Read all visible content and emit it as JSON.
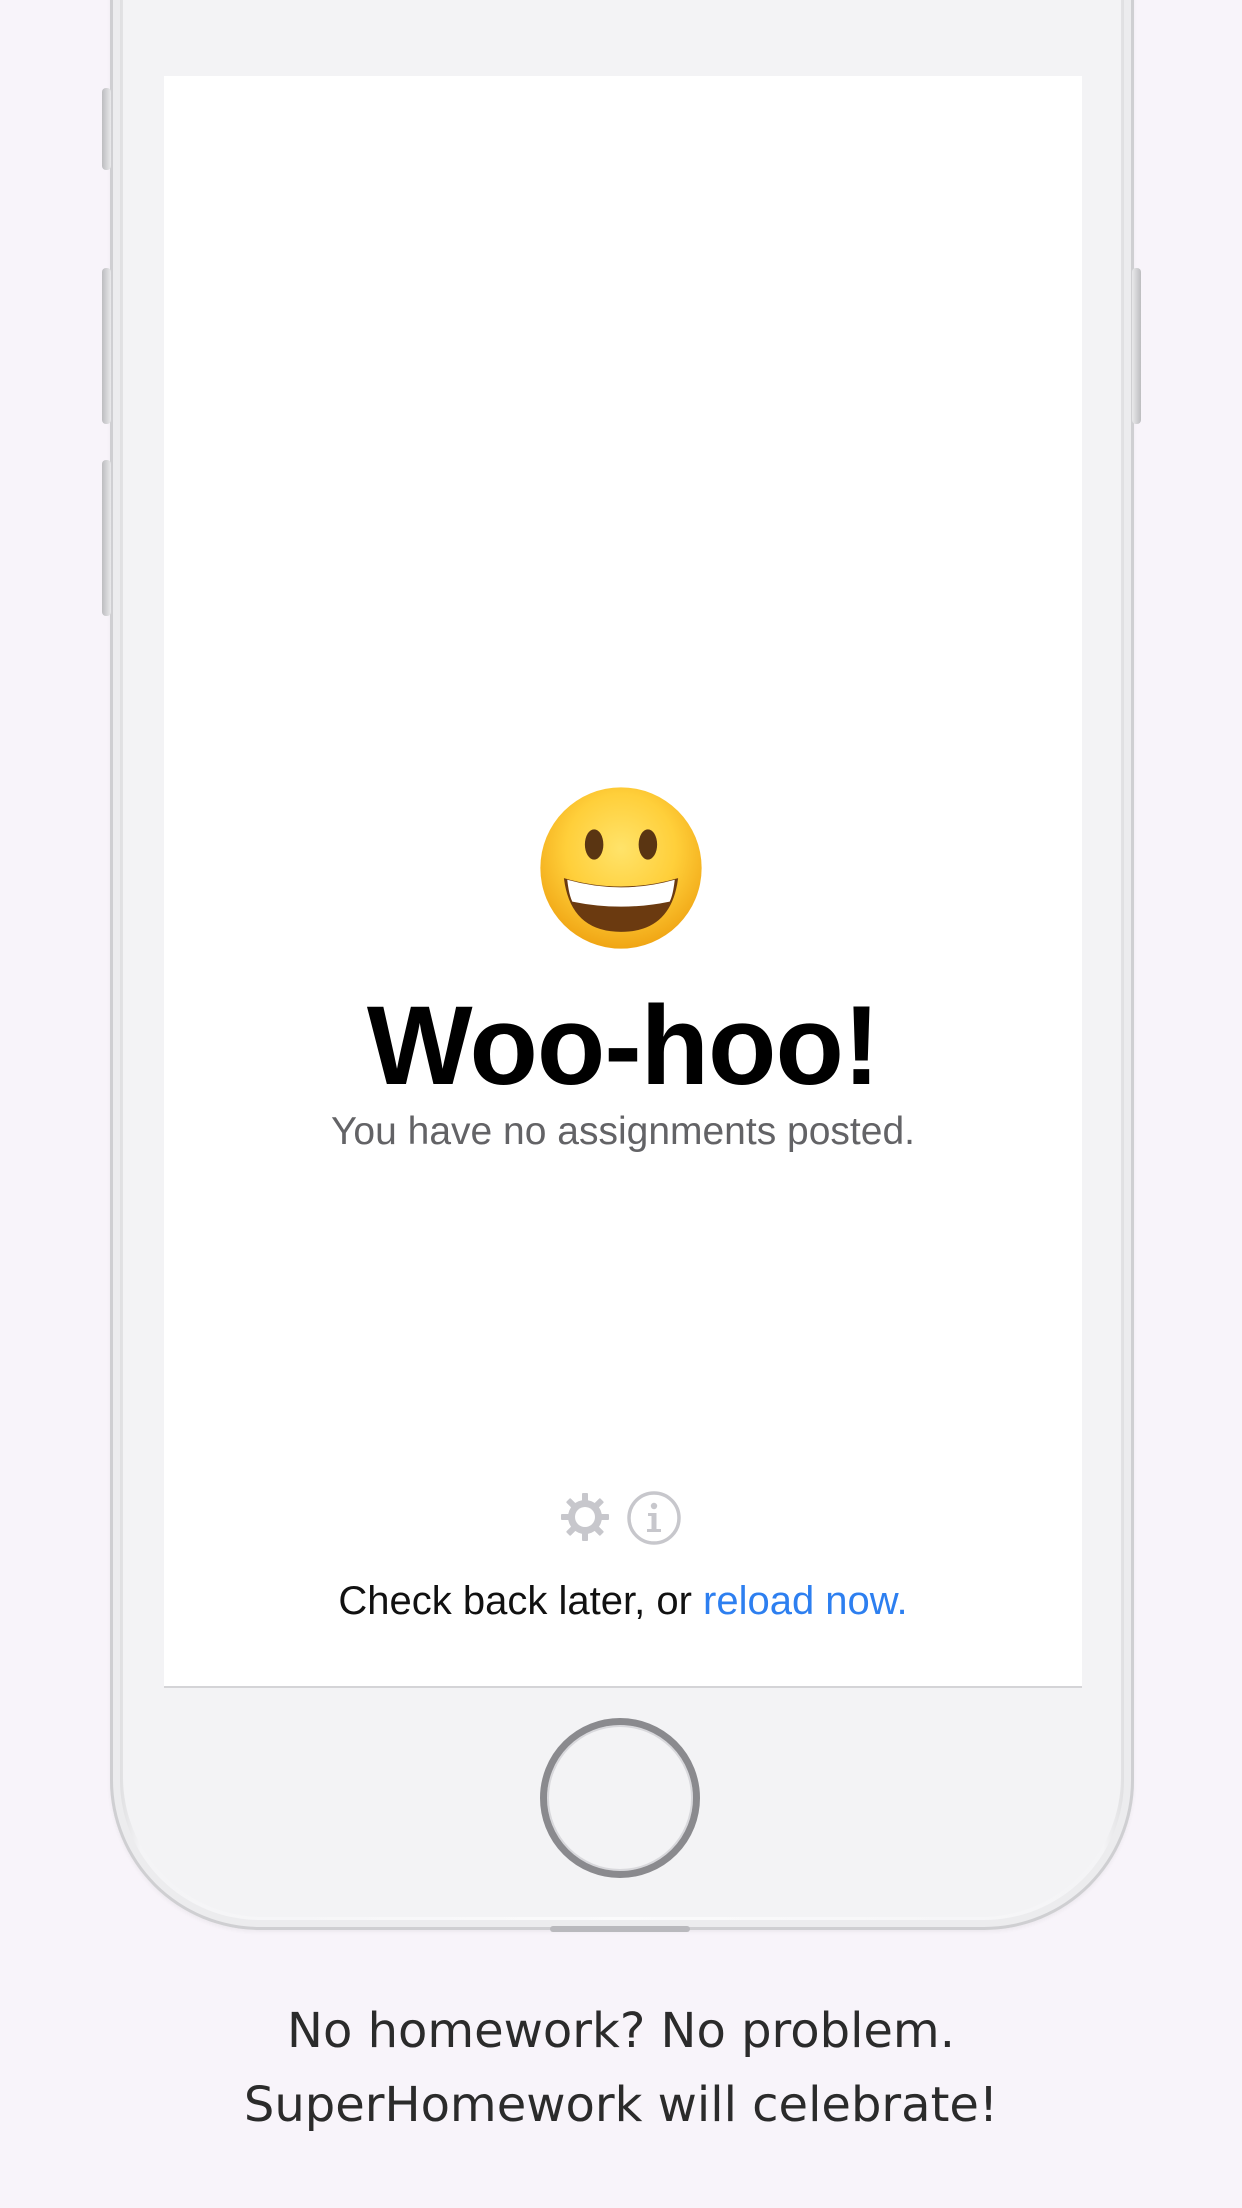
{
  "screen": {
    "emoji": "grinning-face",
    "headline": "Woo-hoo!",
    "subline": "You have no assignments posted.",
    "icons": [
      "gear-icon",
      "info-icon"
    ],
    "footer_prefix": "Check back later, or ",
    "reload_link": "reload now."
  },
  "caption": {
    "line1": "No homework? No problem.",
    "line2": "SuperHomework will celebrate!"
  },
  "colors": {
    "background": "#f8f4fa",
    "link": "#2d7ff0",
    "headline": "#000000",
    "subline": "#636366"
  }
}
